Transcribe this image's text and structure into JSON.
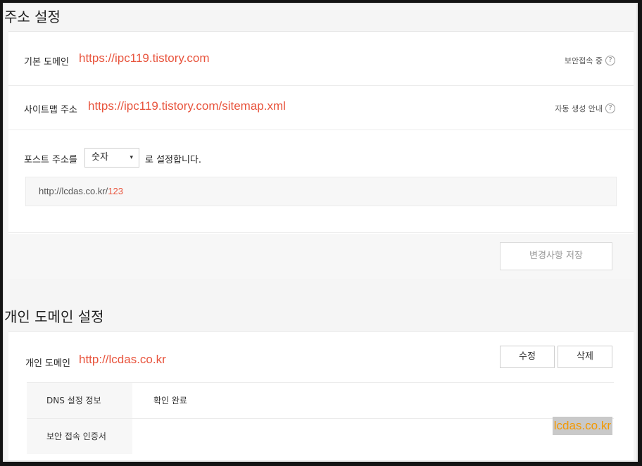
{
  "address_section": {
    "title": "주소 설정",
    "default_domain": {
      "label": "기본 도메인",
      "url": "https://ipc119.tistory.com",
      "note": "보안접속 중"
    },
    "sitemap": {
      "label": "사이트맵 주소",
      "url": "https://ipc119.tistory.com/sitemap.xml",
      "note": "자동 생성 안내"
    },
    "post_address": {
      "prefix": "포스트 주소를",
      "selected_option": "숫자",
      "suffix": "로 설정합니다.",
      "preview_base": "http://lcdas.co.kr/",
      "preview_number": "123"
    },
    "save_button": "변경사항 저장"
  },
  "custom_domain_section": {
    "title": "개인 도메인 설정",
    "label": "개인 도메인",
    "url": "http://lcdas.co.kr",
    "edit_button": "수정",
    "delete_button": "삭제",
    "rows": [
      {
        "key": "DNS 설정 정보",
        "value": "확인 완료"
      },
      {
        "key": "보안 접속 인증서",
        "value": ""
      }
    ]
  },
  "help_icon_glyph": "?",
  "dropdown_arrow_glyph": "▾",
  "watermark": "lcdas.co.kr",
  "colors": {
    "accent_red": "#e8543d",
    "watermark_text": "#f39800"
  }
}
